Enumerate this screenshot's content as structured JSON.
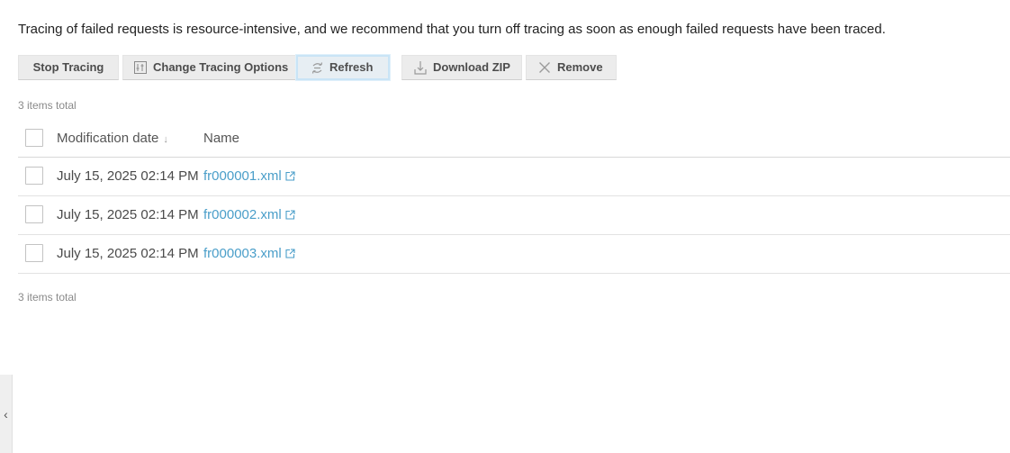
{
  "intro_text": "Tracing of failed requests is resource-intensive, and we recommend that you turn off tracing as soon as enough failed requests have been traced.",
  "toolbar": {
    "stop_label": "Stop Tracing",
    "change_label": "Change Tracing Options",
    "refresh_label": "Refresh",
    "download_label": "Download ZIP",
    "remove_label": "Remove"
  },
  "items_total_top": "3 items total",
  "items_total_bottom": "3 items total",
  "table": {
    "columns": [
      {
        "label": "Modification date",
        "sort": "↓"
      },
      {
        "label": "Name"
      }
    ],
    "rows": [
      {
        "date": "July 15, 2025 02:14 PM",
        "name": "fr000001.xml"
      },
      {
        "date": "July 15, 2025 02:14 PM",
        "name": "fr000002.xml"
      },
      {
        "date": "July 15, 2025 02:14 PM",
        "name": "fr000003.xml"
      }
    ]
  },
  "side_toggle": "‹",
  "icons": {
    "change": "sliders-icon",
    "refresh": "refresh-icon",
    "download": "download-icon",
    "remove": "remove-icon",
    "external": "external-link-icon"
  },
  "colors": {
    "link": "#4a9ec9",
    "button_bg": "#ececec",
    "focus_ring": "#c9e4f6"
  }
}
